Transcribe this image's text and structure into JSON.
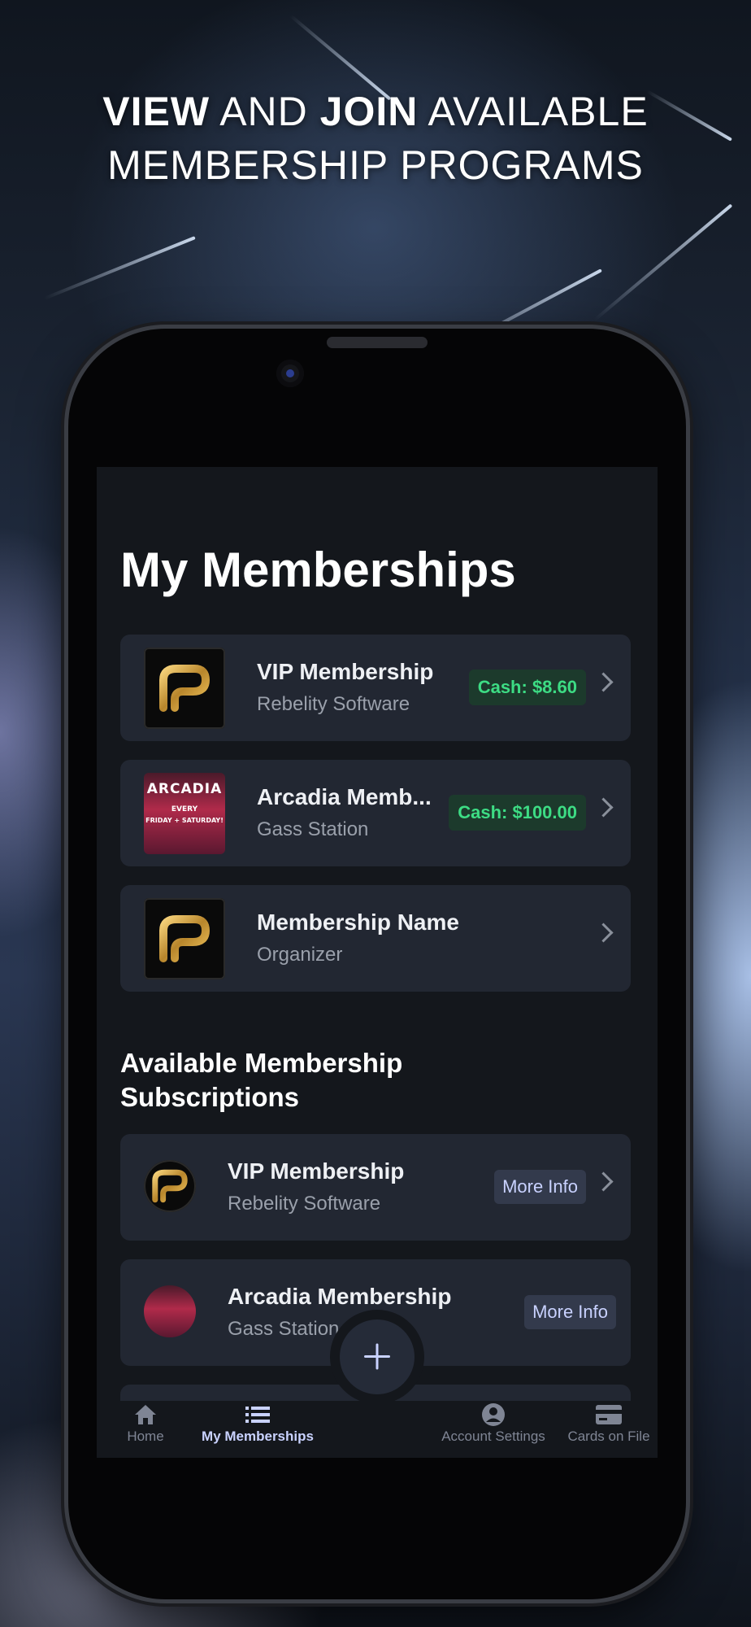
{
  "headline": {
    "line1_bold_a": "VIEW",
    "line1_mid": " AND ",
    "line1_bold_b": "JOIN",
    "line1_end": " AVAILABLE",
    "line2": "MEMBERSHIP PROGRAMS"
  },
  "screen": {
    "title": "My Memberships",
    "my_memberships": [
      {
        "title": "VIP Membership",
        "organizer": "Rebelity Software",
        "cash": "Cash: $8.60",
        "logo": "rebelity-logo"
      },
      {
        "title": "Arcadia Memb...",
        "organizer": "Gass Station",
        "cash": "Cash: $100.00",
        "logo": "arcadia-poster"
      },
      {
        "title": "Membership Name",
        "organizer": "Organizer",
        "cash": "",
        "logo": "rebelity-logo"
      }
    ],
    "arcadia_poster": {
      "top": "ARCADIA",
      "line": "EVERY",
      "days": "FRIDAY + SATURDAY!"
    },
    "section_title": "Available Membership Subscriptions",
    "available": [
      {
        "title": "VIP Membership",
        "organizer": "Rebelity Software",
        "action": "More Info"
      },
      {
        "title": "Arcadia Membership",
        "organizer": "Gass Station",
        "action": "More Info"
      }
    ],
    "fab_icon": "plus-icon",
    "tabs": [
      {
        "label": "Home",
        "icon": "home-icon",
        "active": false
      },
      {
        "label": "My Memberships",
        "icon": "list-icon",
        "active": true
      },
      {
        "label": "Account Settings",
        "icon": "account-icon",
        "active": false
      },
      {
        "label": "Cards on File",
        "icon": "card-icon",
        "active": false
      }
    ]
  },
  "colors": {
    "screen_bg": "#14171c",
    "card_bg": "#222732",
    "cash_bg": "#1c3a2c",
    "cash_text": "#3ddc84",
    "accent": "#c9d2ff"
  }
}
